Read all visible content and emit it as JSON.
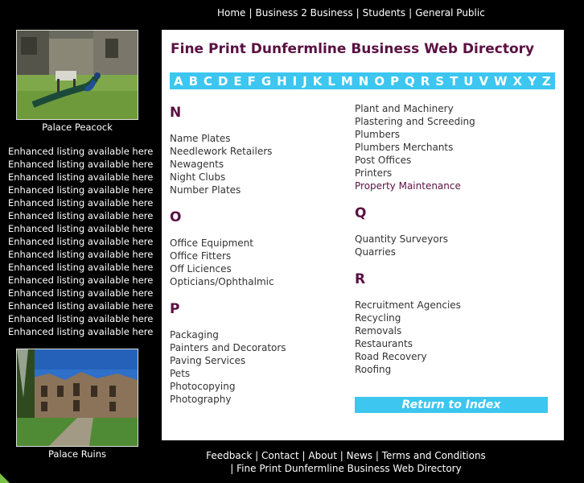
{
  "topnav": {
    "links": [
      "Home",
      "Business 2 Business",
      "Students",
      "General Public"
    ],
    "separator": "|"
  },
  "sidebar": {
    "photo1_caption": "Palace Peacock",
    "photo2_caption": "Palace Ruins",
    "enhanced_listings": [
      "Enhanced listing available here",
      "Enhanced listing available here",
      "Enhanced listing available here",
      "Enhanced listing available here",
      "Enhanced listing available here",
      "Enhanced listing available here",
      "Enhanced listing available here",
      "Enhanced listing available here",
      "Enhanced listing available here",
      "Enhanced listing available here",
      "Enhanced listing available here",
      "Enhanced listing available here",
      "Enhanced listing available here",
      "Enhanced listing available here",
      "Enhanced listing available here"
    ]
  },
  "main": {
    "title": "Fine Print Dunfermline Business Web Directory",
    "alphabet": [
      "A",
      "B",
      "C",
      "D",
      "E",
      "F",
      "G",
      "H",
      "I",
      "J",
      "K",
      "L",
      "M",
      "N",
      "O",
      "P",
      "Q",
      "R",
      "S",
      "T",
      "U",
      "V",
      "W",
      "X",
      "Y",
      "Z"
    ],
    "left_sections": [
      {
        "letter": "N",
        "items": [
          "Name Plates",
          "Needlework Retailers",
          "Newagents",
          "Night Clubs",
          "Number Plates"
        ]
      },
      {
        "letter": "O",
        "items": [
          "Office Equipment",
          "Office Fitters",
          "Off Liciences",
          "Opticians/Ophthalmic"
        ]
      },
      {
        "letter": "P",
        "items": [
          "Packaging",
          "Painters and Decorators",
          "Paving Services",
          "Pets",
          "Photocopying",
          "Photography"
        ]
      }
    ],
    "right_top_items": [
      "Plant and Machinery",
      "Plastering and Screeding",
      "Plumbers",
      "Plumbers Merchants",
      "Post Offices",
      "Printers",
      "Property Maintenance"
    ],
    "right_sections": [
      {
        "letter": "Q",
        "items": [
          "Quantity Surveyors",
          "Quarries"
        ]
      },
      {
        "letter": "R",
        "items": [
          "Recruitment Agencies",
          "Recycling",
          "Removals",
          "Restaurants",
          "Road Recovery",
          "Roofing"
        ]
      }
    ],
    "return_label": "Return to Index"
  },
  "footer": {
    "links": [
      "Feedback",
      "Contact",
      "About",
      "News",
      "Terms and Conditions"
    ],
    "line2": "| Fine Print Dunfermline Business Web Directory"
  },
  "colors": {
    "accent": "#3cc6f0",
    "heading": "#5a1142",
    "background": "#000000"
  }
}
